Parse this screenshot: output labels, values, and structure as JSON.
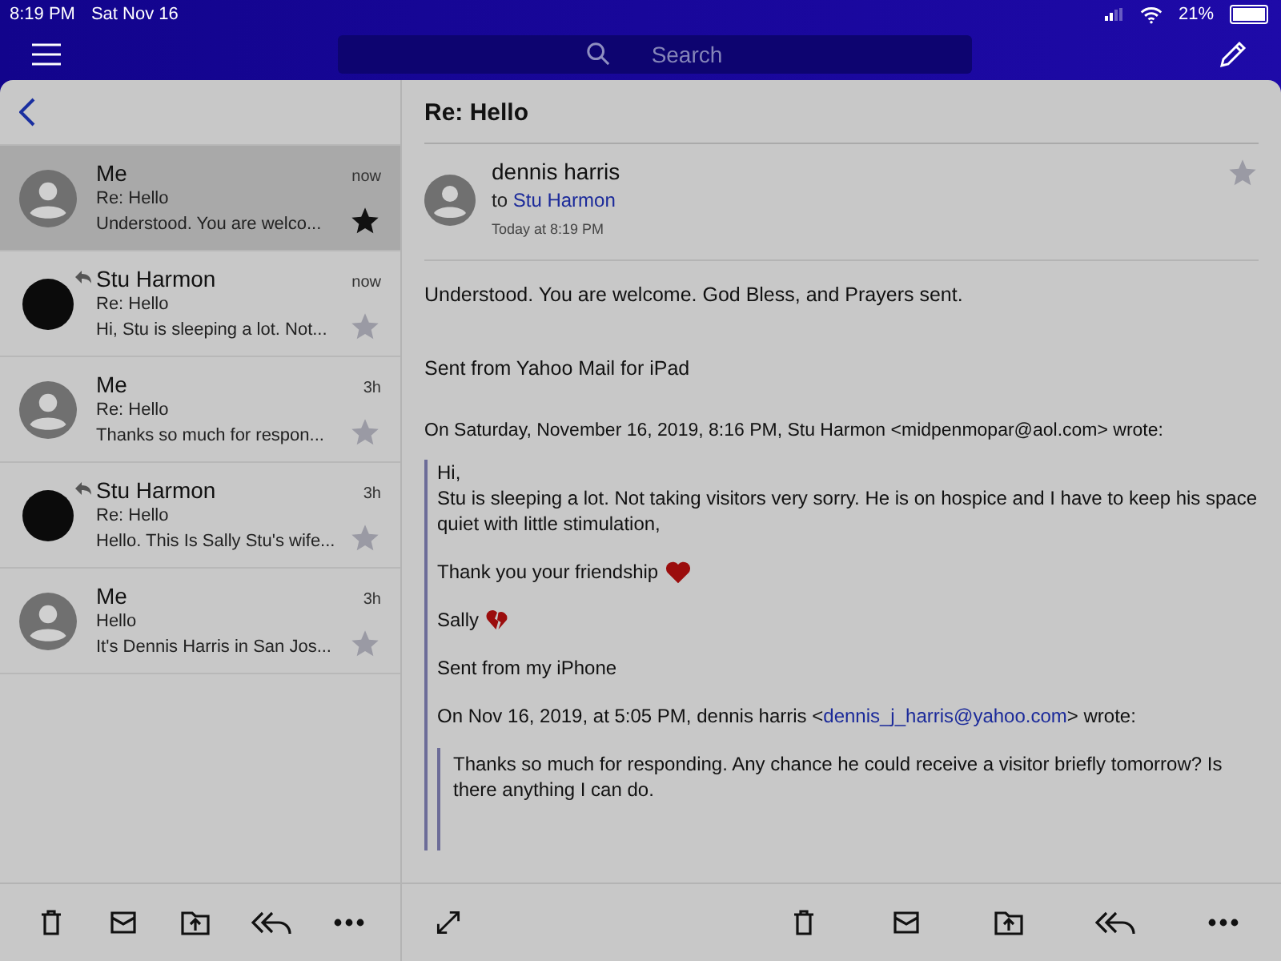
{
  "status_bar": {
    "time": "8:19 PM",
    "date": "Sat Nov 16",
    "battery": "21%"
  },
  "toolbar": {
    "search": {
      "placeholder": "Search"
    }
  },
  "messages": [
    {
      "sender": "Me",
      "subject": "Re: Hello",
      "preview": "Understood. You are welco...",
      "time": "now",
      "selected": true,
      "starred": true,
      "replied": false,
      "kind": "generic"
    },
    {
      "sender": "Stu Harmon",
      "subject": "Re: Hello",
      "preview": "Hi, Stu is sleeping a lot. Not...",
      "time": "now",
      "selected": false,
      "starred": false,
      "replied": true,
      "kind": "photo"
    },
    {
      "sender": "Me",
      "subject": "Re: Hello",
      "preview": "Thanks so much for respon...",
      "time": "3h",
      "selected": false,
      "starred": false,
      "replied": false,
      "kind": "generic"
    },
    {
      "sender": "Stu Harmon",
      "subject": "Re: Hello",
      "preview": "Hello. This Is Sally Stu's wife...",
      "time": "3h",
      "selected": false,
      "starred": false,
      "replied": true,
      "kind": "photo"
    },
    {
      "sender": "Me",
      "subject": "Hello",
      "preview": "It's Dennis Harris in San Jos...",
      "time": "3h",
      "selected": false,
      "starred": false,
      "replied": false,
      "kind": "generic"
    }
  ],
  "detail": {
    "subject": "Re: Hello",
    "sender": "dennis harris",
    "to_prefix": "to",
    "recipient": "Stu Harmon",
    "date": "Today at 8:19 PM",
    "starred": false,
    "body": "Understood. You are welcome.  God Bless, and Prayers sent.",
    "signature": "Sent from Yahoo Mail for iPad",
    "quote_header": "On Saturday, November 16, 2019, 8:16 PM, Stu Harmon <midpenmopar@aol.com> wrote:",
    "quote": [
      {
        "text": "Hi,\nStu is sleeping a lot. Not taking visitors very sorry. He is on hospice and I have to keep his space quiet with little stimulation,",
        "kind": "text"
      },
      {
        "text": "Thank you your friendship",
        "kind": "heart"
      },
      {
        "text": "Sally",
        "kind": "broken_heart"
      },
      {
        "text": "Sent from my iPhone",
        "kind": "text"
      }
    ],
    "attribution": {
      "prefix": "On Nov 16, 2019, at 5:05 PM, dennis harris <",
      "email": "dennis_j_harris@yahoo.com",
      "suffix": "> wrote:"
    },
    "inner_quote": "Thanks so much for responding.   Any chance he could receive a visitor briefly tomorrow? Is there anything I can do."
  }
}
